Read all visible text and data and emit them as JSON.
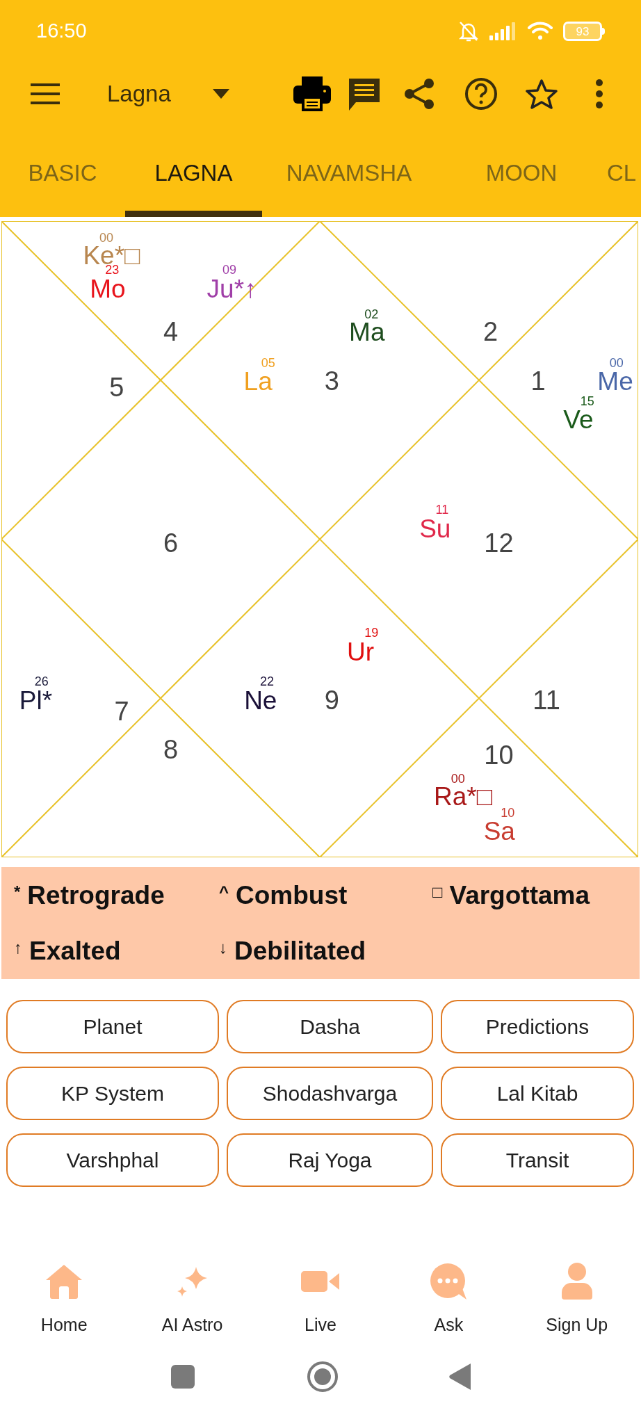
{
  "status_bar": {
    "time": "16:50",
    "battery": "93"
  },
  "app_bar": {
    "title": "Lagna"
  },
  "tabs": [
    {
      "label": "BASIC",
      "selected": false
    },
    {
      "label": "LAGNA",
      "selected": true
    },
    {
      "label": "NAVAMSHA",
      "selected": false
    },
    {
      "label": "MOON",
      "selected": false
    },
    {
      "label": "CL",
      "selected": false
    }
  ],
  "chart": {
    "houses": [
      {
        "number": "4",
        "planets": [
          {
            "name": "Ke*□",
            "degree": "00",
            "color": "#b8864f"
          },
          {
            "name": "Mo",
            "degree": "23",
            "color": "#e8141c"
          },
          {
            "name": "Ju*↑",
            "degree": "09",
            "color": "#a03fa8"
          }
        ]
      },
      {
        "number": "2"
      },
      {
        "number": "5"
      },
      {
        "number": "3",
        "planets": [
          {
            "name": "Ma",
            "degree": "02",
            "color": "#1e4d1e"
          },
          {
            "name": "La",
            "degree": "05",
            "color": "#f0a020"
          }
        ]
      },
      {
        "number": "1",
        "planets": [
          {
            "name": "Me",
            "degree": "00",
            "color": "#4a67a8"
          },
          {
            "name": "Ve",
            "degree": "15",
            "color": "#1a5a1a"
          }
        ]
      },
      {
        "number": "6"
      },
      {
        "number": "12",
        "planets": [
          {
            "name": "Su",
            "degree": "11",
            "color": "#e0284a"
          }
        ]
      },
      {
        "number": "7",
        "planets": [
          {
            "name": "Pl*",
            "degree": "26",
            "color": "#1a1a3a"
          }
        ]
      },
      {
        "number": "9",
        "planets": [
          {
            "name": "Ur",
            "degree": "19",
            "color": "#e01010"
          },
          {
            "name": "Ne",
            "degree": "22",
            "color": "#1a1038"
          }
        ]
      },
      {
        "number": "11"
      },
      {
        "number": "8"
      },
      {
        "number": "10",
        "planets": [
          {
            "name": "Ra*□",
            "degree": "00",
            "color": "#a81818"
          },
          {
            "name": "Sa",
            "degree": "10",
            "color": "#c83c30"
          }
        ]
      }
    ]
  },
  "legend": [
    {
      "symbol": "*",
      "label": "Retrograde"
    },
    {
      "symbol": "^",
      "label": "Combust"
    },
    {
      "symbol": "□",
      "label": "Vargottama"
    },
    {
      "symbol": "↑",
      "label": "Exalted"
    },
    {
      "symbol": "↓",
      "label": "Debilitated"
    }
  ],
  "buttons": [
    "Planet",
    "Dasha",
    "Predictions",
    "KP System",
    "Shodashvarga",
    "Lal Kitab",
    "Varshphal",
    "Raj Yoga",
    "Transit"
  ],
  "bottom_nav": [
    {
      "label": "Home",
      "kind": "home"
    },
    {
      "label": "AI Astro",
      "kind": "sparkle"
    },
    {
      "label": "Live",
      "kind": "video"
    },
    {
      "label": "Ask",
      "kind": "chat"
    },
    {
      "label": "Sign Up",
      "kind": "person"
    }
  ]
}
